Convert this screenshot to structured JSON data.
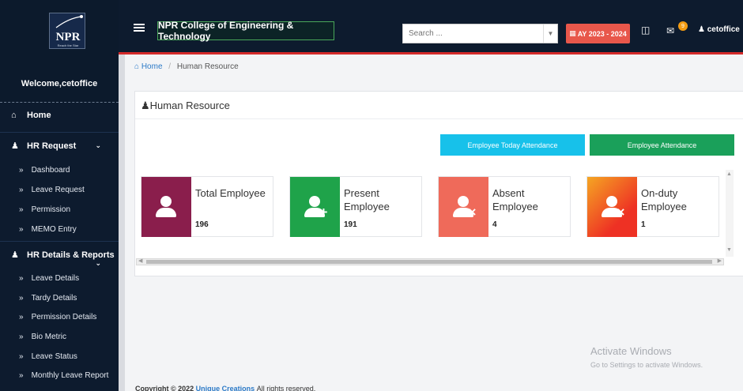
{
  "sidebar": {
    "logo_text": "NPR",
    "logo_tagline": "Reach the Star",
    "welcome": "Welcome,cetoffice",
    "home": "Home",
    "hr_request": "HR Request",
    "hr_request_items": [
      "Dashboard",
      "Leave Request",
      "Permission",
      "MEMO Entry"
    ],
    "hr_details": "HR Details & Reports",
    "hr_details_items": [
      "Leave Details",
      "Tardy Details",
      "Permission Details",
      "Bio Metric",
      "Leave Status",
      "Monthly Leave Report"
    ]
  },
  "topbar": {
    "college": "NPR College of Engineering & Technology",
    "search_placeholder": "Search ...",
    "academic_year": "AY 2023 - 2024",
    "notification_count": "9",
    "user": "cetoffice"
  },
  "breadcrumb": {
    "home": "Home",
    "separator": "/",
    "current": "Human Resource"
  },
  "panel": {
    "title": "Human Resource",
    "btn_today_attendance": "Employee Today Attendance",
    "btn_attendance": "Employee Attendance"
  },
  "cards": [
    {
      "line1": "Total Employee",
      "line2": "",
      "value": "196",
      "color": "#8a1e4c"
    },
    {
      "line1": "Present",
      "line2": "Employee",
      "value": "191",
      "color": "#1fa34a"
    },
    {
      "line1": "Absent",
      "line2": "Employee",
      "value": "4",
      "color": "#ef6a5a"
    },
    {
      "line1": "On-duty",
      "line2": "Employee",
      "value": "1",
      "color": "#f26b2a"
    }
  ],
  "watermark": {
    "title": "Activate Windows",
    "subtitle": "Go to Settings to activate Windows."
  },
  "footer": {
    "prefix": "Copyright © 2022",
    "link": "Unique Creations",
    "suffix": "All rights reserved."
  },
  "colors": {
    "sidebar_bg": "#0d1b2e",
    "accent_red": "#d42a2a",
    "ay_badge": "#e8574b",
    "btn_cyan": "#17c1ea",
    "btn_green": "#1aa05a"
  }
}
